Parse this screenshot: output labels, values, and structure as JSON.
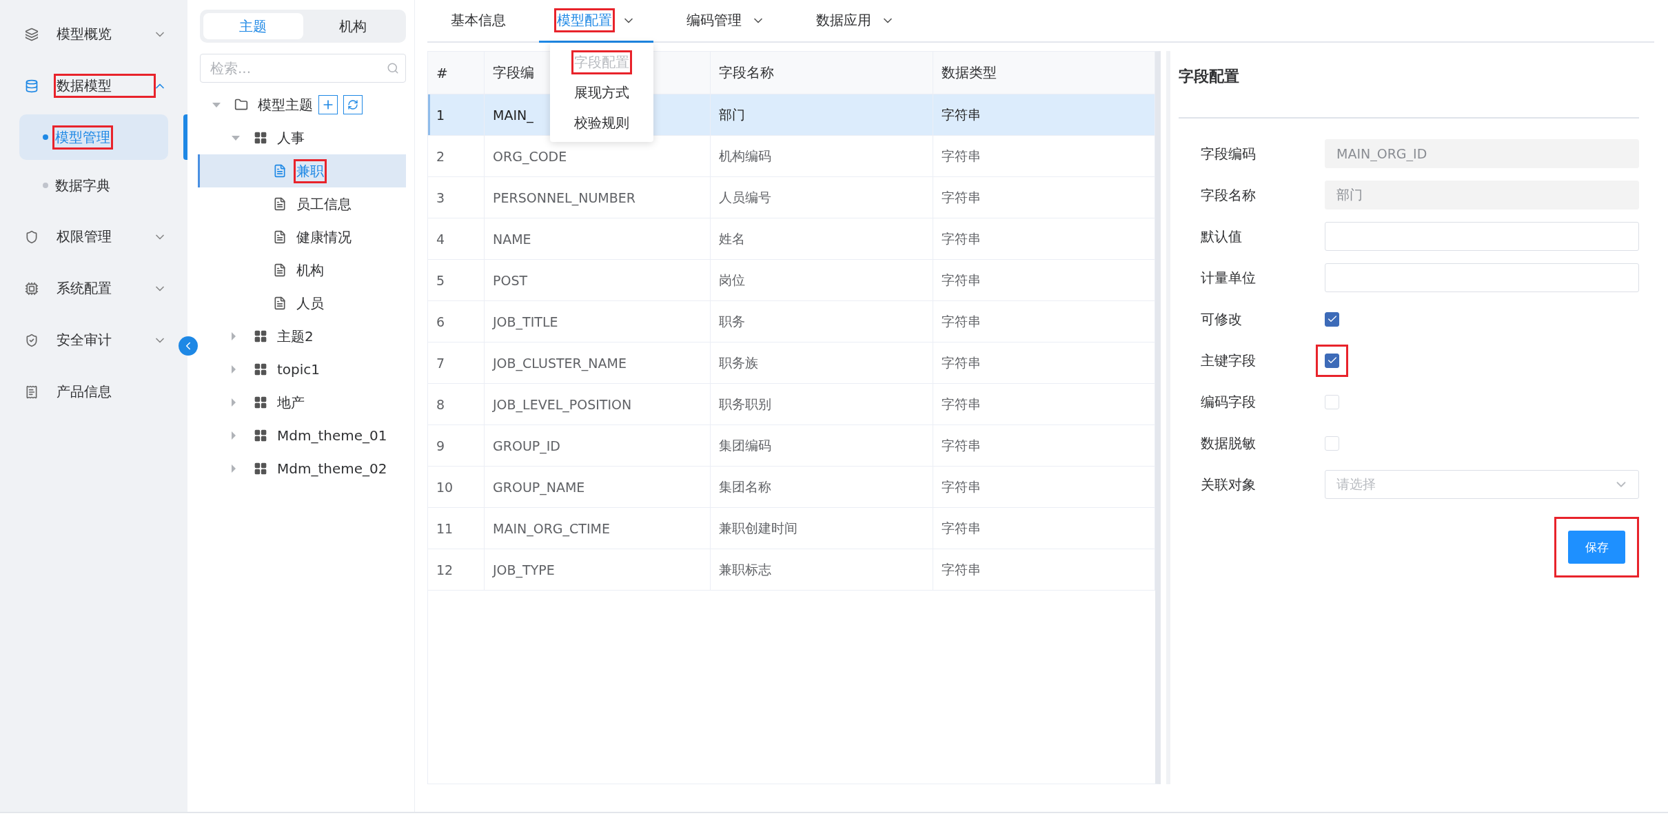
{
  "sidebar": {
    "items": [
      {
        "label": "模型概览",
        "expanded": false,
        "selected": false
      },
      {
        "label": "数据模型",
        "expanded": true,
        "selected": true,
        "highlighted": true,
        "children": [
          {
            "label": "模型管理",
            "selected": true,
            "highlighted": true
          },
          {
            "label": "数据字典",
            "selected": false
          }
        ]
      },
      {
        "label": "权限管理",
        "expanded": false,
        "selected": false
      },
      {
        "label": "系统配置",
        "expanded": false,
        "selected": false
      },
      {
        "label": "安全审计",
        "expanded": false,
        "selected": false
      },
      {
        "label": "产品信息",
        "selected": false
      }
    ]
  },
  "tree_panel": {
    "toggle": [
      {
        "label": "主题",
        "selected": true
      },
      {
        "label": "机构",
        "selected": false
      }
    ],
    "search": {
      "placeholder": "检索..."
    },
    "tree": [
      {
        "label": "模型主题",
        "kind": "folder",
        "expanded": true,
        "selected": false,
        "children": [
          {
            "label": "人事",
            "kind": "group",
            "expanded": true,
            "selected": false,
            "children": [
              {
                "label": "兼职",
                "kind": "doc",
                "selected": true,
                "highlighted": true
              },
              {
                "label": "员工信息",
                "kind": "doc",
                "selected": false
              },
              {
                "label": "健康情况",
                "kind": "doc",
                "selected": false
              },
              {
                "label": "机构",
                "kind": "doc",
                "selected": false
              },
              {
                "label": "人员",
                "kind": "doc",
                "selected": false
              }
            ]
          },
          {
            "label": "主题2",
            "kind": "group",
            "expanded": false,
            "selected": false
          },
          {
            "label": "topic1",
            "kind": "group",
            "expanded": false,
            "selected": false
          },
          {
            "label": "地产",
            "kind": "group",
            "expanded": false,
            "selected": false
          },
          {
            "label": "Mdm_theme_01",
            "kind": "group",
            "expanded": false,
            "selected": false
          },
          {
            "label": "Mdm_theme_02",
            "kind": "group",
            "expanded": false,
            "selected": false
          }
        ]
      }
    ]
  },
  "tabs": [
    {
      "label": "基本信息",
      "selected": false,
      "dropdown": false
    },
    {
      "label": "模型配置",
      "selected": true,
      "dropdown": true,
      "highlighted": true,
      "menu": [
        {
          "label": "字段配置",
          "disabled": true,
          "highlighted": true
        },
        {
          "label": "展现方式",
          "disabled": false
        },
        {
          "label": "校验规则",
          "disabled": false
        }
      ]
    },
    {
      "label": "编码管理",
      "selected": false,
      "dropdown": true
    },
    {
      "label": "数据应用",
      "selected": false,
      "dropdown": true
    }
  ],
  "table": {
    "columns": [
      "#",
      "字段编",
      "字段名称",
      "数据类型"
    ],
    "rows": [
      {
        "cells": [
          "1",
          "MAIN_",
          "部门",
          "字符串"
        ],
        "selected": true
      },
      {
        "cells": [
          "2",
          "ORG_CODE",
          "机构编码",
          "字符串"
        ],
        "selected": false
      },
      {
        "cells": [
          "3",
          "PERSONNEL_NUMBER",
          "人员编号",
          "字符串"
        ],
        "selected": false
      },
      {
        "cells": [
          "4",
          "NAME",
          "姓名",
          "字符串"
        ],
        "selected": false
      },
      {
        "cells": [
          "5",
          "POST",
          "岗位",
          "字符串"
        ],
        "selected": false
      },
      {
        "cells": [
          "6",
          "JOB_TITLE",
          "职务",
          "字符串"
        ],
        "selected": false
      },
      {
        "cells": [
          "7",
          "JOB_CLUSTER_NAME",
          "职务族",
          "字符串"
        ],
        "selected": false
      },
      {
        "cells": [
          "8",
          "JOB_LEVEL_POSITION",
          "职务职别",
          "字符串"
        ],
        "selected": false
      },
      {
        "cells": [
          "9",
          "GROUP_ID",
          "集团编码",
          "字符串"
        ],
        "selected": false
      },
      {
        "cells": [
          "10",
          "GROUP_NAME",
          "集团名称",
          "字符串"
        ],
        "selected": false
      },
      {
        "cells": [
          "11",
          "MAIN_ORG_CTIME",
          "兼职创建时间",
          "字符串"
        ],
        "selected": false
      },
      {
        "cells": [
          "12",
          "JOB_TYPE",
          "兼职标志",
          "字符串"
        ],
        "selected": false
      }
    ]
  },
  "field_config": {
    "title": "字段配置",
    "fields": [
      {
        "label": "字段编码",
        "kind": "text",
        "value": "MAIN_ORG_ID",
        "disabled": true
      },
      {
        "label": "字段名称",
        "kind": "text",
        "value": "部门",
        "disabled": true
      },
      {
        "label": "默认值",
        "kind": "text",
        "disabled": false
      },
      {
        "label": "计量单位",
        "kind": "text",
        "disabled": false
      },
      {
        "label": "可修改",
        "kind": "checkbox",
        "checked": true
      },
      {
        "label": "主键字段",
        "kind": "checkbox",
        "checked": true,
        "highlighted": true
      },
      {
        "label": "编码字段",
        "kind": "checkbox",
        "checked": false
      },
      {
        "label": "数据脱敏",
        "kind": "checkbox",
        "checked": false
      },
      {
        "label": "关联对象",
        "kind": "select",
        "placeholder": "请选择"
      }
    ],
    "save_button": {
      "label": "保存",
      "highlighted": true
    }
  }
}
